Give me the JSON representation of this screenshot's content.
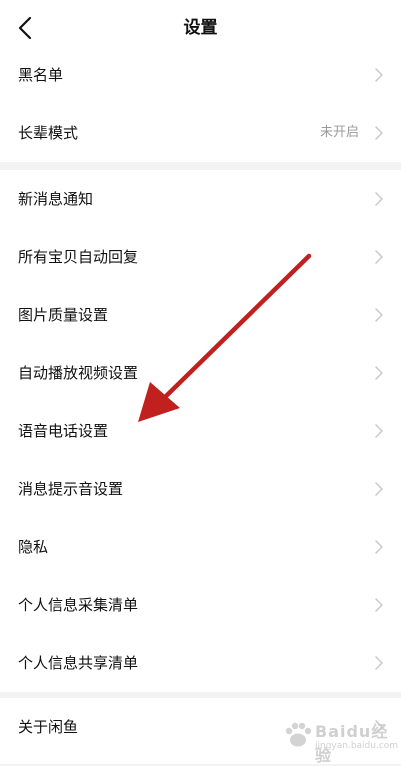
{
  "header": {
    "title": "设置",
    "back_icon": "chevron-left-icon"
  },
  "groups": [
    {
      "items": [
        {
          "label": "黑名单",
          "value": ""
        },
        {
          "label": "长辈模式",
          "value": "未开启"
        }
      ]
    },
    {
      "items": [
        {
          "label": "新消息通知",
          "value": ""
        },
        {
          "label": "所有宝贝自动回复",
          "value": ""
        },
        {
          "label": "图片质量设置",
          "value": ""
        },
        {
          "label": "自动播放视频设置",
          "value": ""
        },
        {
          "label": "语音电话设置",
          "value": ""
        },
        {
          "label": "消息提示音设置",
          "value": ""
        },
        {
          "label": "隐私",
          "value": ""
        },
        {
          "label": "个人信息采集清单",
          "value": ""
        },
        {
          "label": "个人信息共享清单",
          "value": ""
        }
      ]
    },
    {
      "items": [
        {
          "label": "关于闲鱼",
          "value": ""
        }
      ]
    }
  ],
  "annotation": {
    "color": "#c0201e"
  },
  "watermark": {
    "text": "Baidu经验",
    "url": "jingyan.baidu.com"
  },
  "colors": {
    "background": "#f3f3f3",
    "row_background": "#ffffff",
    "text": "#111111",
    "secondary_text": "#9a9a9a",
    "chevron": "#c8c8c8"
  }
}
